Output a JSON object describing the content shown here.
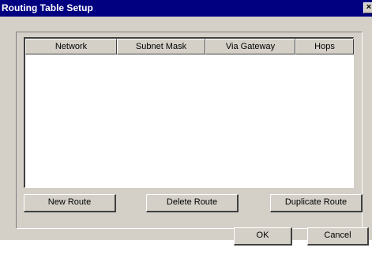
{
  "window": {
    "title": "Routing Table Setup",
    "close_glyph": "×"
  },
  "routes_table": {
    "columns": [
      "Network",
      "Subnet Mask",
      "Via Gateway",
      "Hops"
    ],
    "rows": []
  },
  "actions": {
    "new_route": "New Route",
    "delete_route": "Delete Route",
    "duplicate_route": "Duplicate Route"
  },
  "dialog_buttons": {
    "ok": "OK",
    "cancel": "Cancel"
  },
  "colors": {
    "titlebar": "#000080",
    "face": "#d4d0c8",
    "list_background": "#ffffff"
  }
}
